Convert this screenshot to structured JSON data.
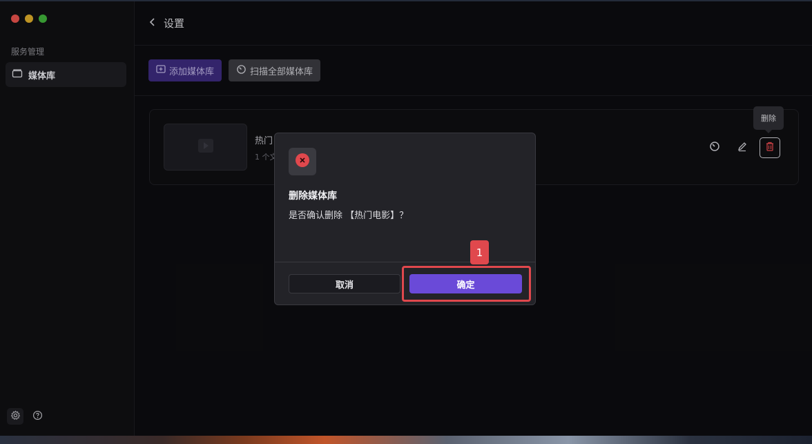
{
  "sidebar": {
    "section_title": "服务管理",
    "items": [
      {
        "label": "媒体库",
        "icon": "folder-icon",
        "active": true
      }
    ],
    "bottom_icons": [
      "gear-icon",
      "help-icon"
    ]
  },
  "header": {
    "back_icon": "chevron-left-icon",
    "title": "设置"
  },
  "toolbar": {
    "add_library_label": "添加媒体库",
    "scan_all_label": "扫描全部媒体库"
  },
  "library_card": {
    "name": "热门",
    "count": "1 个文",
    "actions": [
      "scan-icon",
      "edit-icon",
      "trash-icon"
    ]
  },
  "tooltip": {
    "text": "删除"
  },
  "dialog": {
    "icon": "error-icon",
    "title": "删除媒体库",
    "message": "是否确认删除 【热门电影】？",
    "cancel_label": "取消",
    "confirm_label": "确定"
  },
  "annotation": {
    "marker_label": "1"
  },
  "colors": {
    "accent": "#6a4ad8",
    "danger": "#e0484d",
    "background": "#0c0c0f"
  }
}
